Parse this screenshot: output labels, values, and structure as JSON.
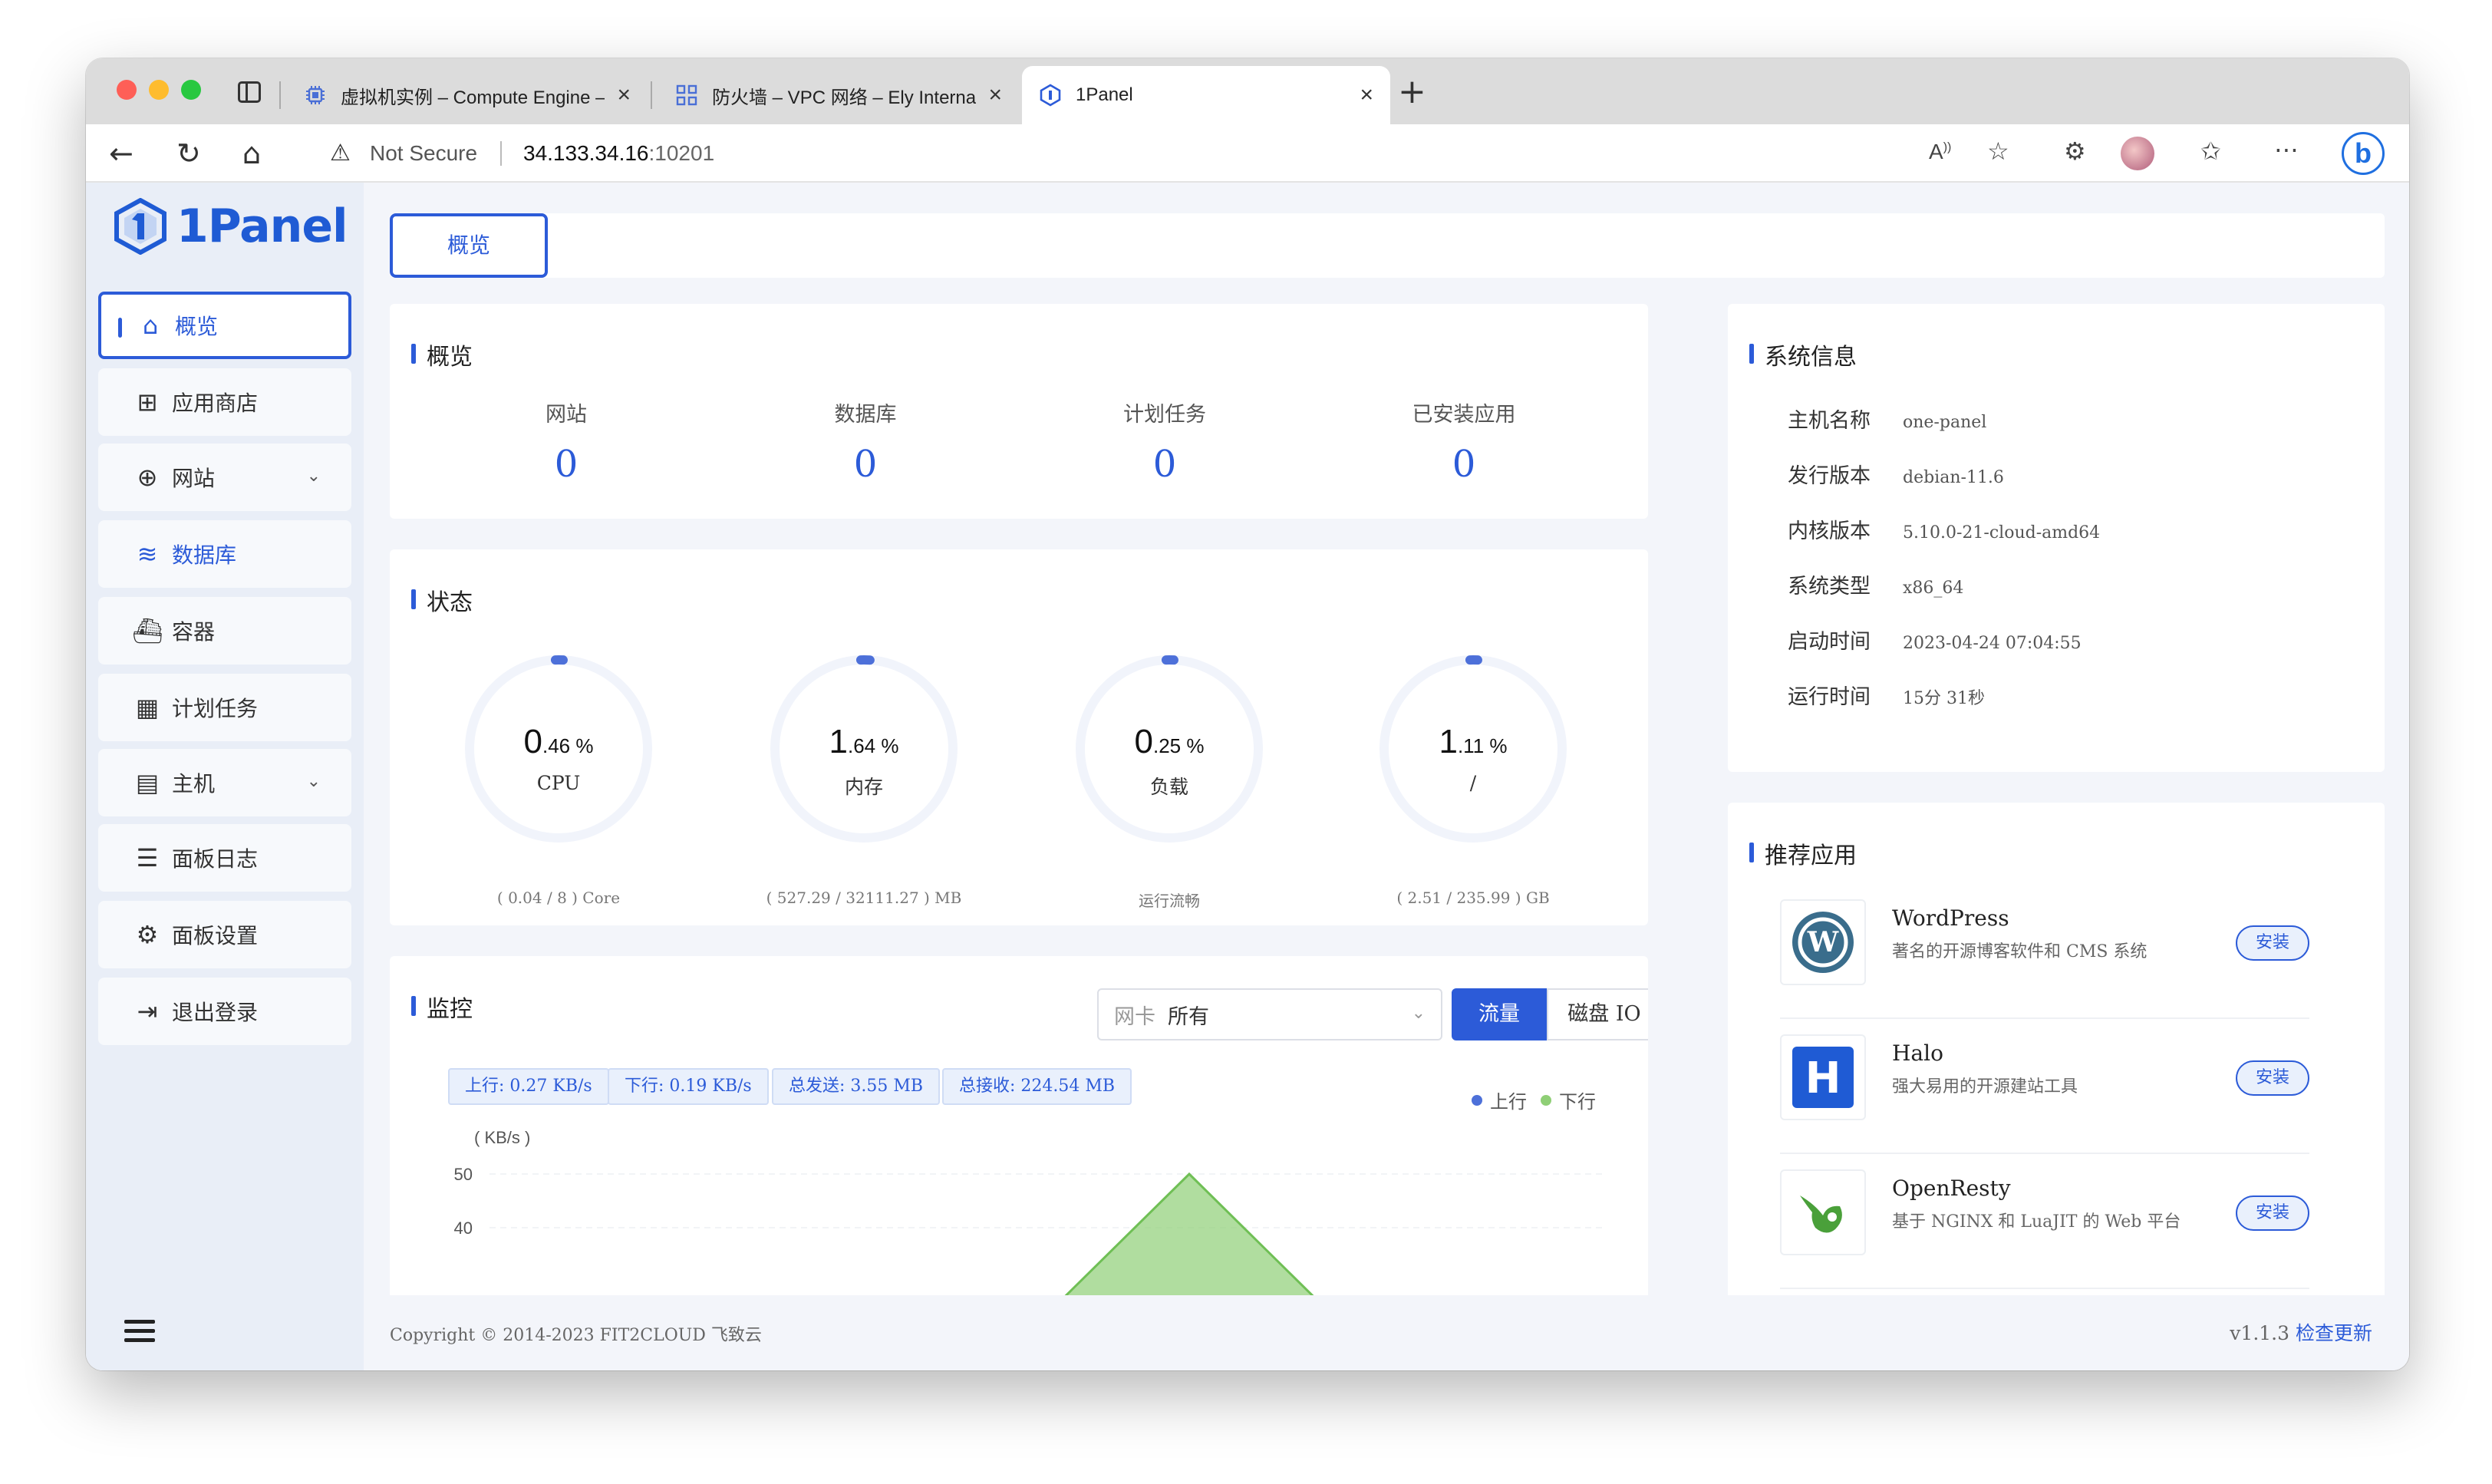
{
  "browser": {
    "tabs": [
      {
        "title": "虚拟机实例 – Compute Engine –",
        "active": false
      },
      {
        "title": "防火墙 – VPC 网络 – Ely Internal",
        "active": false
      },
      {
        "title": "1Panel",
        "active": true
      }
    ],
    "url_warning": "Not Secure",
    "url_host": "34.133.34.16",
    "url_port": ":10201"
  },
  "logo": {
    "text": "1Panel"
  },
  "sidebar": {
    "items": [
      {
        "label": "概览",
        "icon": "home-icon"
      },
      {
        "label": "应用商店",
        "icon": "grid-icon"
      },
      {
        "label": "网站",
        "icon": "globe-icon"
      },
      {
        "label": "数据库",
        "icon": "layers-icon"
      },
      {
        "label": "容器",
        "icon": "docker-icon"
      },
      {
        "label": "计划任务",
        "icon": "calendar-icon"
      },
      {
        "label": "主机",
        "icon": "server-icon"
      },
      {
        "label": "面板日志",
        "icon": "log-icon"
      },
      {
        "label": "面板设置",
        "icon": "gear-icon"
      },
      {
        "label": "退出登录",
        "icon": "logout-icon"
      }
    ]
  },
  "top_tab": {
    "label": "概览"
  },
  "overview": {
    "title": "概览",
    "items": [
      {
        "label": "网站",
        "value": "0"
      },
      {
        "label": "数据库",
        "value": "0"
      },
      {
        "label": "计划任务",
        "value": "0"
      },
      {
        "label": "已安装应用",
        "value": "0"
      }
    ]
  },
  "status": {
    "title": "状态",
    "gauges": [
      {
        "int": "0",
        "dec": ".46",
        "unit": " %",
        "label": "CPU",
        "sub": "( 0.04 / 8 ) Core",
        "percent": 0.46
      },
      {
        "int": "1",
        "dec": ".64",
        "unit": " %",
        "label": "内存",
        "sub": "( 527.29 / 32111.27 ) MB",
        "percent": 1.64
      },
      {
        "int": "0",
        "dec": ".25",
        "unit": " %",
        "label": "负载",
        "sub": "运行流畅",
        "percent": 0.25
      },
      {
        "int": "1",
        "dec": ".11",
        "unit": " %",
        "label": "/",
        "sub": "( 2.51 / 235.99 ) GB",
        "percent": 1.11
      }
    ]
  },
  "monitor": {
    "title": "监控",
    "nic_prefix": "网卡",
    "nic_value": "所有",
    "seg_traffic": "流量",
    "seg_disk": "磁盘 IO",
    "chips": [
      "上行: 0.27 KB/s",
      "下行: 0.19 KB/s",
      "总发送: 3.55 MB",
      "总接收: 224.54 MB"
    ],
    "legend_up": "上行",
    "legend_down": "下行",
    "color_up": "#4d70d9",
    "color_down": "#8fcf76"
  },
  "chart_data": {
    "type": "area",
    "ylabel": "( KB/s )",
    "y_ticks": [
      "50",
      "40"
    ],
    "series": [
      {
        "name": "下行",
        "values": [
          0,
          50,
          0
        ]
      }
    ]
  },
  "sysinfo": {
    "title": "系统信息",
    "rows": [
      {
        "k": "主机名称",
        "v": "one-panel"
      },
      {
        "k": "发行版本",
        "v": "debian-11.6"
      },
      {
        "k": "内核版本",
        "v": "5.10.0-21-cloud-amd64"
      },
      {
        "k": "系统类型",
        "v": "x86_64"
      },
      {
        "k": "启动时间",
        "v": "2023-04-24 07:04:55"
      },
      {
        "k": "运行时间",
        "v": "15分 31秒"
      }
    ]
  },
  "apps": {
    "title": "推荐应用",
    "install_label": "安装",
    "items": [
      {
        "name": "WordPress",
        "desc": "著名的开源博客软件和 CMS 系统",
        "icon": "wordpress-icon"
      },
      {
        "name": "Halo",
        "desc": "强大易用的开源建站工具",
        "icon": "halo-icon"
      },
      {
        "name": "OpenResty",
        "desc": "基于 NGINX 和 LuaJIT 的 Web 平台",
        "icon": "openresty-icon"
      }
    ]
  },
  "footer": {
    "copyright": "Copyright © 2014-2023 FIT2CLOUD 飞致云",
    "version": "v1.1.3",
    "check_update": "检查更新"
  }
}
